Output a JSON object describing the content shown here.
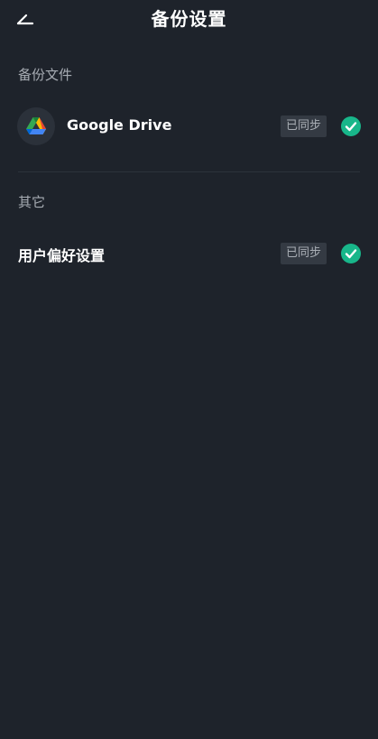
{
  "header": {
    "title": "备份设置",
    "back_icon": "back-arrow-icon"
  },
  "sections": [
    {
      "label": "备份文件",
      "items": [
        {
          "title": "Google Drive",
          "icon": "google-drive-icon",
          "status": "已同步",
          "status_icon": "check-circle-icon"
        }
      ]
    },
    {
      "label": "其它",
      "items": [
        {
          "title": "用户偏好设置",
          "status": "已同步",
          "status_icon": "check-circle-icon"
        }
      ]
    }
  ],
  "colors": {
    "background": "#1e232b",
    "accent_check": "#18b68a",
    "badge_bg": "#343a43",
    "muted_text": "#a7acb3"
  }
}
